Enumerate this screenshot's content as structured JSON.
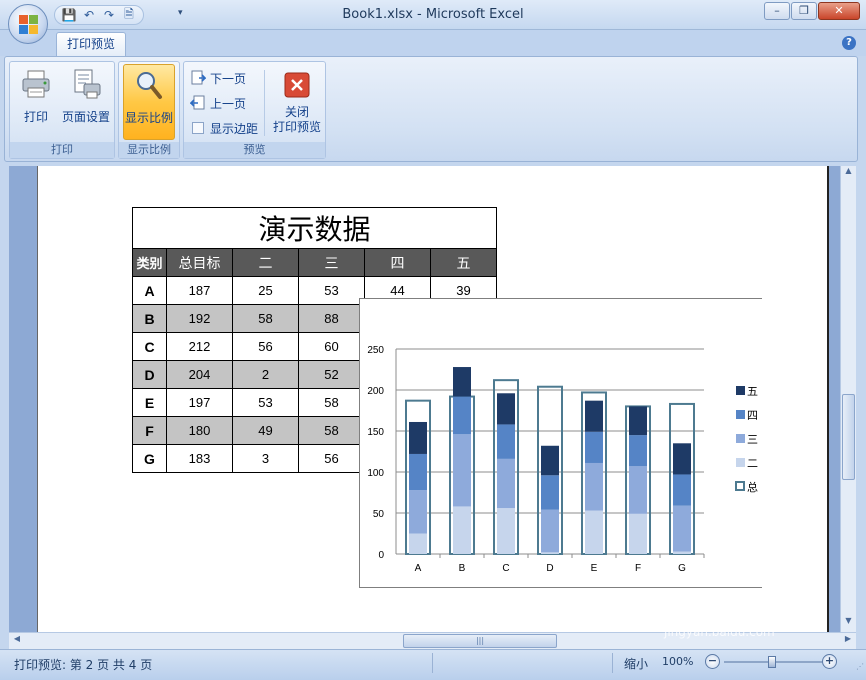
{
  "window": {
    "title": "Book1.xlsx - Microsoft Excel"
  },
  "qat": {
    "save": "💾",
    "undo": "↶",
    "redo": "↷",
    "print_preview": "🗎",
    "more": "▾"
  },
  "window_buttons": {
    "minimize": "–",
    "restore": "❐",
    "close": "✕"
  },
  "ribbon": {
    "tab": "打印预览",
    "help": "?",
    "groups": {
      "print": {
        "label": "打印",
        "print_btn": "打印",
        "page_setup_btn": "页面设置"
      },
      "zoom": {
        "label": "显示比例",
        "zoom_btn": "显示比例"
      },
      "preview": {
        "label": "预览",
        "next_page": "下一页",
        "prev_page": "上一页",
        "show_margins": "显示边距",
        "close_line1": "关闭",
        "close_line2": "打印预览"
      }
    }
  },
  "sheet": {
    "title": "演示数据",
    "headers": [
      "类别",
      "总目标",
      "二",
      "三",
      "四",
      "五"
    ],
    "rows": [
      [
        "A",
        "187",
        "25",
        "53",
        "44",
        "39"
      ],
      [
        "B",
        "192",
        "58",
        "88",
        "",
        ""
      ],
      [
        "C",
        "212",
        "56",
        "60",
        "",
        ""
      ],
      [
        "D",
        "204",
        "2",
        "52",
        "",
        ""
      ],
      [
        "E",
        "197",
        "53",
        "58",
        "",
        ""
      ],
      [
        "F",
        "180",
        "49",
        "58",
        "",
        ""
      ],
      [
        "G",
        "183",
        "3",
        "56",
        "",
        ""
      ]
    ]
  },
  "chart_data": {
    "type": "bar",
    "categories": [
      "A",
      "B",
      "C",
      "D",
      "E",
      "F",
      "G"
    ],
    "ylim": [
      0,
      250
    ],
    "yticks": [
      0,
      50,
      100,
      150,
      200,
      250
    ],
    "grid": true,
    "legend_position": "right",
    "series": [
      {
        "name": "二",
        "values": [
          25,
          58,
          56,
          2,
          53,
          49,
          3
        ],
        "color": "#c6d5ec"
      },
      {
        "name": "三",
        "values": [
          53,
          88,
          60,
          52,
          58,
          58,
          56
        ],
        "color": "#8eaadb"
      },
      {
        "name": "四",
        "values": [
          44,
          46,
          42,
          42,
          38,
          38,
          38
        ],
        "color": "#5584c6"
      },
      {
        "name": "五",
        "values": [
          39,
          36,
          38,
          36,
          38,
          35,
          38
        ],
        "color": "#1e3a66"
      }
    ],
    "target": {
      "name": "总目标",
      "values": [
        187,
        192,
        212,
        204,
        197,
        180,
        183
      ],
      "color": "#4d7a90"
    },
    "legend_visible": [
      "五",
      "四",
      "三",
      "二",
      "总"
    ]
  },
  "scroll": {
    "up": "▲",
    "down": "▼",
    "left": "◀",
    "right": "▶",
    "grip": "|||"
  },
  "status": {
    "text": "打印预览: 第 2 页 共 4 页",
    "zoom_label": "缩小",
    "zoom_pct": "100%",
    "zoom_out": "−",
    "zoom_in": "+",
    "grip": "⋰"
  },
  "watermark": {
    "brand": "Bai 经验",
    "url": "jingyan.baidu.com"
  }
}
